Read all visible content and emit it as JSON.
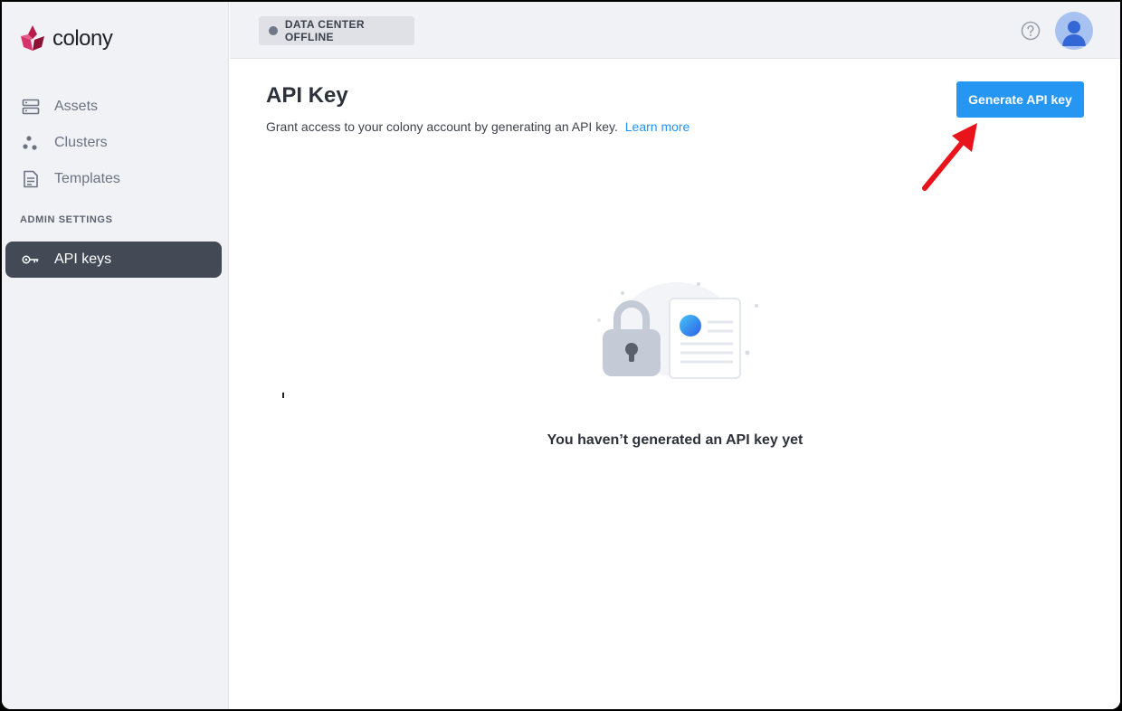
{
  "brand": {
    "name": "colony"
  },
  "sidebar": {
    "items": [
      {
        "label": "Assets",
        "icon": "server-icon"
      },
      {
        "label": "Clusters",
        "icon": "clusters-icon"
      },
      {
        "label": "Templates",
        "icon": "document-icon"
      }
    ],
    "section_label": "ADMIN SETTINGS",
    "admin_items": [
      {
        "label": "API keys",
        "icon": "key-icon",
        "active": true
      }
    ]
  },
  "header": {
    "status_badge": "DATA CENTER OFFLINE",
    "help_icon": "help-circle-icon",
    "avatar_icon": "user-avatar-icon"
  },
  "main": {
    "title": "API Key",
    "description": "Grant access to your colony account by generating an API key.",
    "learn_more": "Learn more",
    "generate_button": "Generate API key",
    "empty_state": "You haven’t generated an API key yet"
  },
  "colors": {
    "accent": "#2696f3",
    "sidebar_active": "#434a56",
    "annotation_arrow": "#e8131b"
  }
}
